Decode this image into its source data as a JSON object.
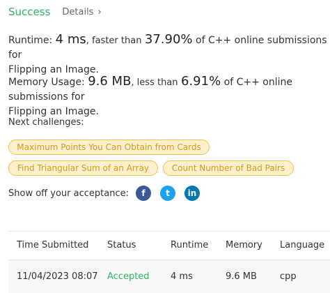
{
  "header": {
    "status": "Success",
    "details_label": "Details",
    "details_chevron": "›"
  },
  "runtime": {
    "label": "Runtime:",
    "value": "4 ms",
    "comparison": ", faster than",
    "percent": "37.90%",
    "suffix": "of C++ online submissions for",
    "problem": "Flipping an Image."
  },
  "memory": {
    "label": "Memory Usage:",
    "value": "9.6 MB",
    "comparison": ", less than",
    "percent": "6.91%",
    "suffix": "of C++ online submissions for",
    "problem": "Flipping an Image."
  },
  "next_challenges": {
    "label": "Next challenges:",
    "items": [
      "Maximum Points You Can Obtain from Cards",
      "Find Triangular Sum of an Array",
      "Count Number of Bad Pairs"
    ]
  },
  "share": {
    "label": "Show off your acceptance:",
    "icons": [
      "facebook-icon",
      "twitter-icon",
      "linkedin-icon"
    ],
    "glyphs": [
      "f",
      "t",
      "in"
    ]
  },
  "submissions": {
    "columns": [
      "Time Submitted",
      "Status",
      "Runtime",
      "Memory",
      "Language"
    ],
    "rows": [
      {
        "time": "11/04/2023 08:07",
        "status": "Accepted",
        "runtime": "4 ms",
        "memory": "9.6 MB",
        "language": "cpp"
      }
    ]
  },
  "colors": {
    "success": "#2db55d",
    "pill_border": "#f0c243",
    "pill_bg": "#fdf0cc",
    "pill_text": "#d69a1d"
  }
}
